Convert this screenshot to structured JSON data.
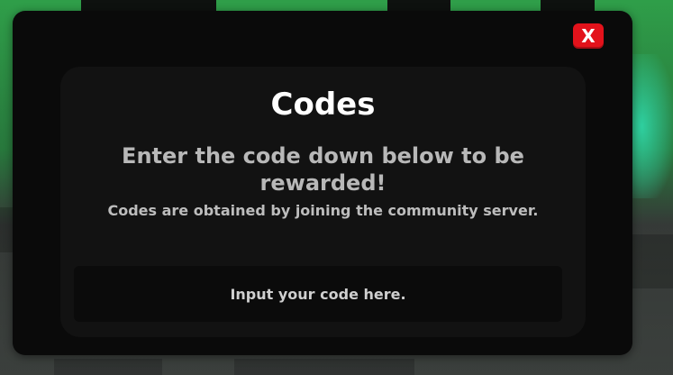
{
  "modal": {
    "title": "Codes",
    "subtitle": "Enter the code down below to be rewarded!",
    "note": "Codes are obtained by joining the community server.",
    "close_label": "X",
    "code_input": {
      "placeholder": "Input your code here.",
      "value": ""
    }
  },
  "colors": {
    "modal_background": "#0a0a0a",
    "panel_background": "#121212",
    "close_button": "#e3121b",
    "title_text": "#ffffff",
    "subtitle_text": "#b8b8b8"
  }
}
